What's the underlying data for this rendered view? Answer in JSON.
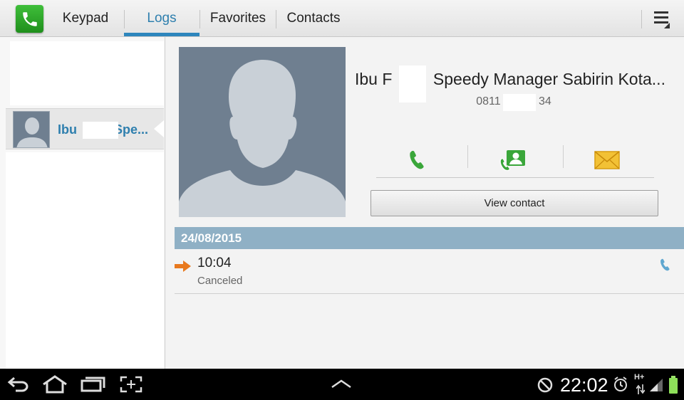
{
  "tabs": [
    {
      "label": "Keypad"
    },
    {
      "label": "Logs"
    },
    {
      "label": "Favorites"
    },
    {
      "label": "Contacts"
    }
  ],
  "active_tab": "Logs",
  "log_list": {
    "items": [
      {
        "name": "Ibu",
        "name_tail": "Spe..."
      }
    ]
  },
  "contact": {
    "name": "Ibu F         Speedy Manager Sabirin Kota...",
    "number": "0811            34",
    "view_contact_label": "View contact"
  },
  "history": {
    "date": "24/08/2015",
    "entries": [
      {
        "time": "10:04",
        "status": "Canceled"
      }
    ]
  },
  "status_bar": {
    "time": "22:02",
    "network": "H+"
  },
  "colors": {
    "accent": "#2e86bd",
    "date_header": "#8fb0c5",
    "call_green": "#3aa63a",
    "outgoing_arrow": "#e8791e"
  }
}
